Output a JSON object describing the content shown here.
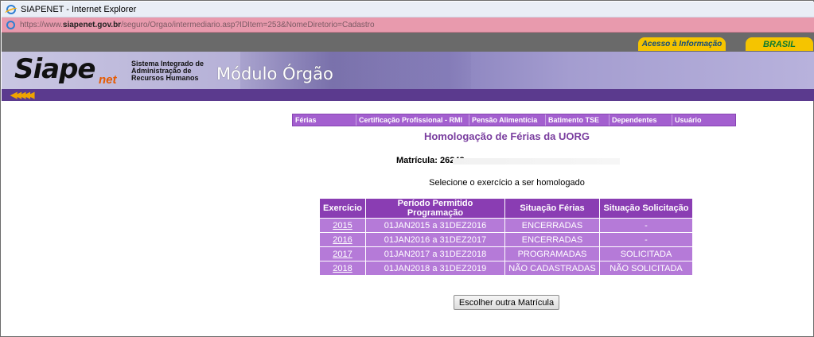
{
  "window": {
    "title": "SIAPENET - Internet Explorer"
  },
  "address": {
    "prefix": "https://www.",
    "host": "siapenet.gov.br",
    "path": "/seguro/Orgao/intermediario.asp?IDItem=253&NomeDiretorio=Cadastro"
  },
  "gov_bar": {
    "acesso": "Acesso à Informação",
    "brasil": "BRASIL"
  },
  "banner": {
    "logo": "Siape",
    "logo_sub": "net",
    "system_name": "Sistema Integrado de Administração de Recursos Humanos",
    "module": "Módulo Órgão",
    "back_arrows": "◀◀◀◀◀"
  },
  "menu": {
    "items": [
      "Férias",
      "Certificação Profissional - RMI",
      "Pensão Alimentícia",
      "Batimento TSE",
      "Dependentes",
      "Usuário"
    ]
  },
  "page": {
    "title": "Homologação de Férias da UORG",
    "matricula_label": "Matrícula: 26248",
    "instruction": "Selecione o exercício a ser homologado"
  },
  "table": {
    "headers": [
      "Exercício",
      "Período Permitido Programação",
      "Situação Férias",
      "Situação Solicitação"
    ],
    "rows": [
      [
        "2015",
        "01JAN2015 a 31DEZ2016",
        "ENCERRADAS",
        "-"
      ],
      [
        "2016",
        "01JAN2016 a 31DEZ2017",
        "ENCERRADAS",
        "-"
      ],
      [
        "2017",
        "01JAN2017 a 31DEZ2018",
        "PROGRAMADAS",
        "SOLICITADA"
      ],
      [
        "2018",
        "01JAN2018 a 31DEZ2019",
        "NÃO CADASTRADAS",
        "NÃO SOLICITADA"
      ]
    ]
  },
  "button": {
    "label": "Escolher outra Matrícula"
  }
}
